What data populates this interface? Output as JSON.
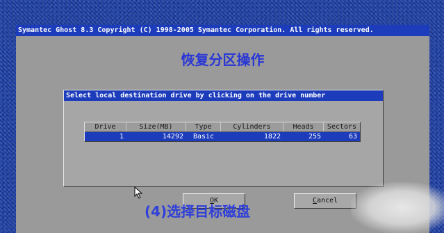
{
  "header": {
    "copyright_line": "Symantec Ghost 8.3   Copyright (C) 1998-2005 Symantec Corporation. All rights reserved."
  },
  "annotation": {
    "title": "恢复分区操作",
    "caption": "(4)选择目标磁盘"
  },
  "dialog": {
    "title": "Select local destination drive by clicking on the drive number",
    "columns": [
      "Drive",
      "Size(MB)",
      "Type",
      "Cylinders",
      "Heads",
      "Sectors"
    ],
    "rows": [
      {
        "drive": "1",
        "size_mb": "14292",
        "type": "Basic",
        "cylinders": "1822",
        "heads": "255",
        "sectors": "63"
      }
    ],
    "buttons": {
      "ok": {
        "hotkey": "O",
        "rest": "K"
      },
      "cancel": {
        "hotkey": "C",
        "rest": "ancel"
      }
    }
  },
  "colors": {
    "title_bar": "#1c3cbb",
    "selected_row": "#1c3cbb",
    "screen_gray": "#9a9a9a",
    "annotation_text": "#2f3fd9"
  },
  "icons": [
    "mouse-pointer-icon"
  ]
}
